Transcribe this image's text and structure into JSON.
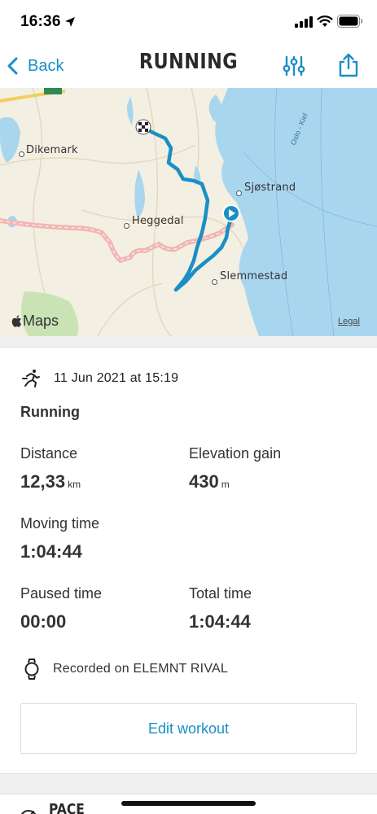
{
  "status_bar": {
    "time": "16:36",
    "icons": [
      "location-arrow-icon",
      "cellular-signal-icon",
      "wifi-icon",
      "battery-icon"
    ]
  },
  "nav": {
    "back_label": "Back",
    "title": "RUNNING",
    "icons": [
      "chevron-left-icon",
      "filter-sliders-icon",
      "share-icon"
    ],
    "accent_color": "#1a8fc4"
  },
  "map": {
    "places": {
      "dikemark": "Dikemark",
      "heggedal": "Heggedal",
      "sjostrand": "Sjøstrand",
      "slemmestad": "Slemmestad"
    },
    "water_label": "Oslo - Kiel",
    "attribution": "Maps",
    "legal": "Legal",
    "route_color": "#1a8fc4",
    "water_color": "#a9d6ef",
    "land_color": "#f3efe3"
  },
  "workout": {
    "date": "11 Jun 2021 at 15:19",
    "activity": "Running",
    "stats": {
      "distance": {
        "label": "Distance",
        "value": "12,33",
        "unit": "km"
      },
      "elevation_gain": {
        "label": "Elevation gain",
        "value": "430",
        "unit": "m"
      },
      "moving_time": {
        "label": "Moving time",
        "value": "1:04:44"
      },
      "paused_time": {
        "label": "Paused time",
        "value": "00:00"
      },
      "total_time": {
        "label": "Total time",
        "value": "1:04:44"
      }
    },
    "recorded_on": "Recorded on ELEMNT RIVAL",
    "edit_label": "Edit workout"
  },
  "next_section": {
    "title": "PACE",
    "icon": "speedometer-icon"
  }
}
